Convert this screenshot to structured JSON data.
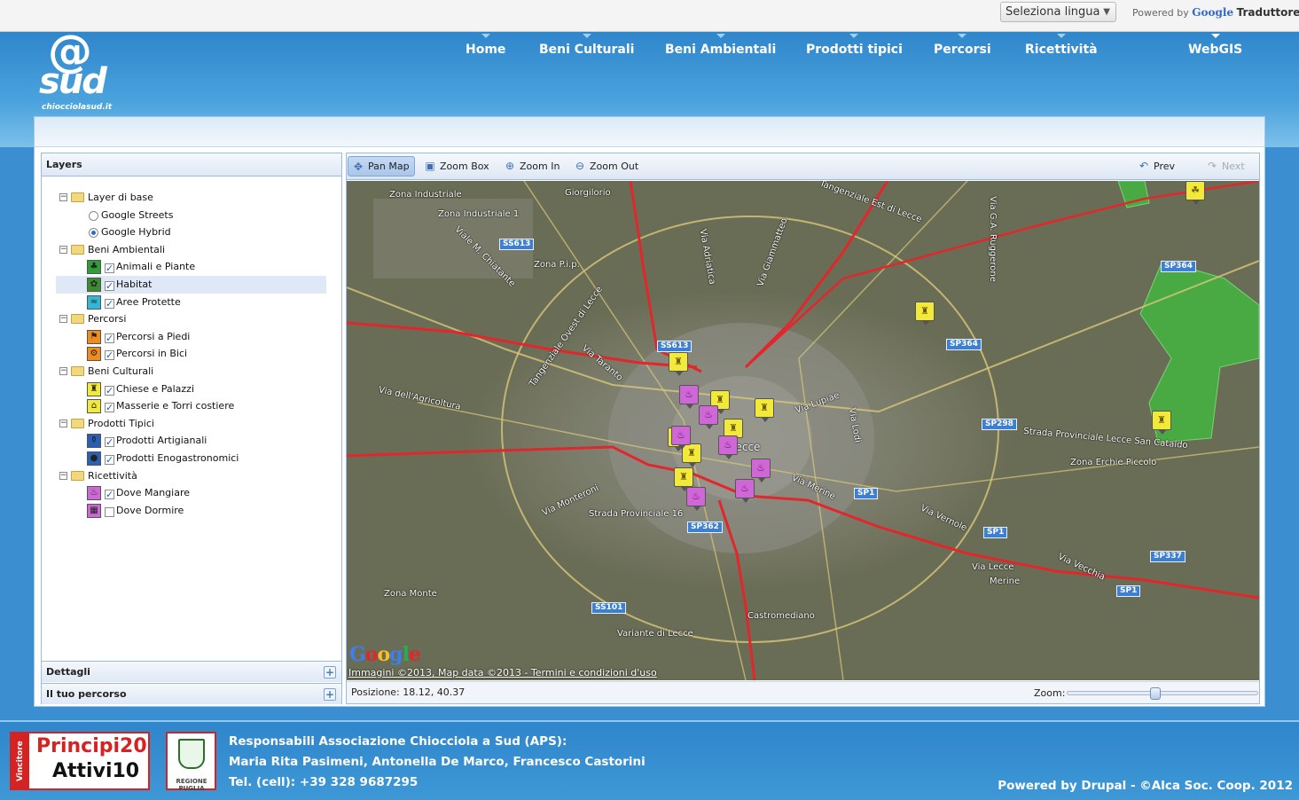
{
  "translator": {
    "select_label": "Seleziona lingua",
    "powered_by": "Powered by",
    "google": "Google",
    "translator": "Traduttore"
  },
  "site": {
    "logo_at": "@",
    "logo_name": "sud",
    "logo_domain": "chiocciolasud.it"
  },
  "nav": [
    "Home",
    "Beni Culturali",
    "Beni Ambientali",
    "Prodotti tipici",
    "Percorsi",
    "Ricettività",
    "WebGIS"
  ],
  "nav_active": "WebGIS",
  "layers": {
    "title": "Layers",
    "groups": [
      {
        "label": "Layer di base",
        "items": [
          {
            "label": "Google Streets",
            "type": "radio",
            "checked": false,
            "icon": "none"
          },
          {
            "label": "Google Hybrid",
            "type": "radio",
            "checked": true,
            "icon": "none"
          }
        ]
      },
      {
        "label": "Beni Ambientali",
        "items": [
          {
            "label": "Animali e Piante",
            "type": "check",
            "checked": true,
            "icon": "clover-icon"
          },
          {
            "label": "Habitat",
            "type": "check",
            "checked": true,
            "icon": "plant-icon",
            "selected": true
          },
          {
            "label": "Aree Protette",
            "type": "check",
            "checked": true,
            "icon": "water-icon"
          }
        ]
      },
      {
        "label": "Percorsi",
        "items": [
          {
            "label": "Percorsi a Piedi",
            "type": "check",
            "checked": true,
            "icon": "hiker-icon"
          },
          {
            "label": "Percorsi in Bici",
            "type": "check",
            "checked": true,
            "icon": "bicycle-icon"
          }
        ]
      },
      {
        "label": "Beni Culturali",
        "items": [
          {
            "label": "Chiese e Palazzi",
            "type": "check",
            "checked": true,
            "icon": "church-icon"
          },
          {
            "label": "Masserie e Torri costiere",
            "type": "check",
            "checked": true,
            "icon": "farmhouse-icon"
          }
        ]
      },
      {
        "label": "Prodotti Tipici",
        "items": [
          {
            "label": "Prodotti Artigianali",
            "type": "check",
            "checked": true,
            "icon": "vase-icon"
          },
          {
            "label": "Prodotti Enogastronomici",
            "type": "check",
            "checked": true,
            "icon": "fish-icon"
          }
        ]
      },
      {
        "label": "Ricettività",
        "items": [
          {
            "label": "Dove Mangiare",
            "type": "check",
            "checked": true,
            "icon": "dish-icon"
          },
          {
            "label": "Dove Dormire",
            "type": "check",
            "checked": false,
            "icon": "bed-icon"
          }
        ]
      }
    ],
    "dettagli": "Dettagli",
    "percorso": "Il tuo percorso"
  },
  "toolbar": {
    "pan": "Pan Map",
    "zoom_box": "Zoom Box",
    "zoom_in": "Zoom In",
    "zoom_out": "Zoom Out",
    "prev": "Prev",
    "next": "Next"
  },
  "map": {
    "labels": [
      "Zona Industriale",
      "Zona Industriale 1",
      "Giorgilorio",
      "Tangenziale Est di Lecce",
      "Viale M. Chiatante",
      "Zona P.i.p.",
      "Via Adriatica",
      "Via Giammatteo",
      "Via G.A. Rugge­rone",
      "Tangenziale Ovest di Lecce",
      "Via Taranto",
      "Via dell'Agricoltura",
      "Via Lupiae",
      "Via Lodi",
      "Strada Provinciale Lecce San Cataldo",
      "Zona Erchie Piccolo",
      "Via Monteroni",
      "Strada Provinciale 16",
      "Via Merine",
      "Via Vernole",
      "Via Lecce",
      "Merine",
      "Via Vecchia",
      "Zona Monte",
      "Castromediano",
      "Variante di Lecce",
      "Lecce"
    ],
    "shields": [
      "SS613",
      "SS613",
      "SP364",
      "SP364",
      "SP298",
      "SP1",
      "SP1",
      "SP337",
      "SP1",
      "SP362",
      "SS101"
    ],
    "attribution": "Immagini ©2013, Map data ©2013 - Termini e condizioni d'uso",
    "google_logo": "Google"
  },
  "status": {
    "position": "Posizione: 18.12, 40.37",
    "zoom_label": "Zoom:",
    "zoom_level": 0.46
  },
  "footer": {
    "badge1_side": "Vincitore",
    "badge1_line1": "Principi20",
    "badge1_line2": "Attivi10",
    "badge2_caption": "REGIONE PUGLIA",
    "line1": "Responsabili Associazione Chiocciola a Sud (APS):",
    "line2": "Maria Rita Pasimeni, Antonella De Marco, Francesco Castorini",
    "line3": "Tel. (cell): +39 328 9687295",
    "powered": "Powered by Drupal - ©Alca Soc. Coop. 2012"
  }
}
